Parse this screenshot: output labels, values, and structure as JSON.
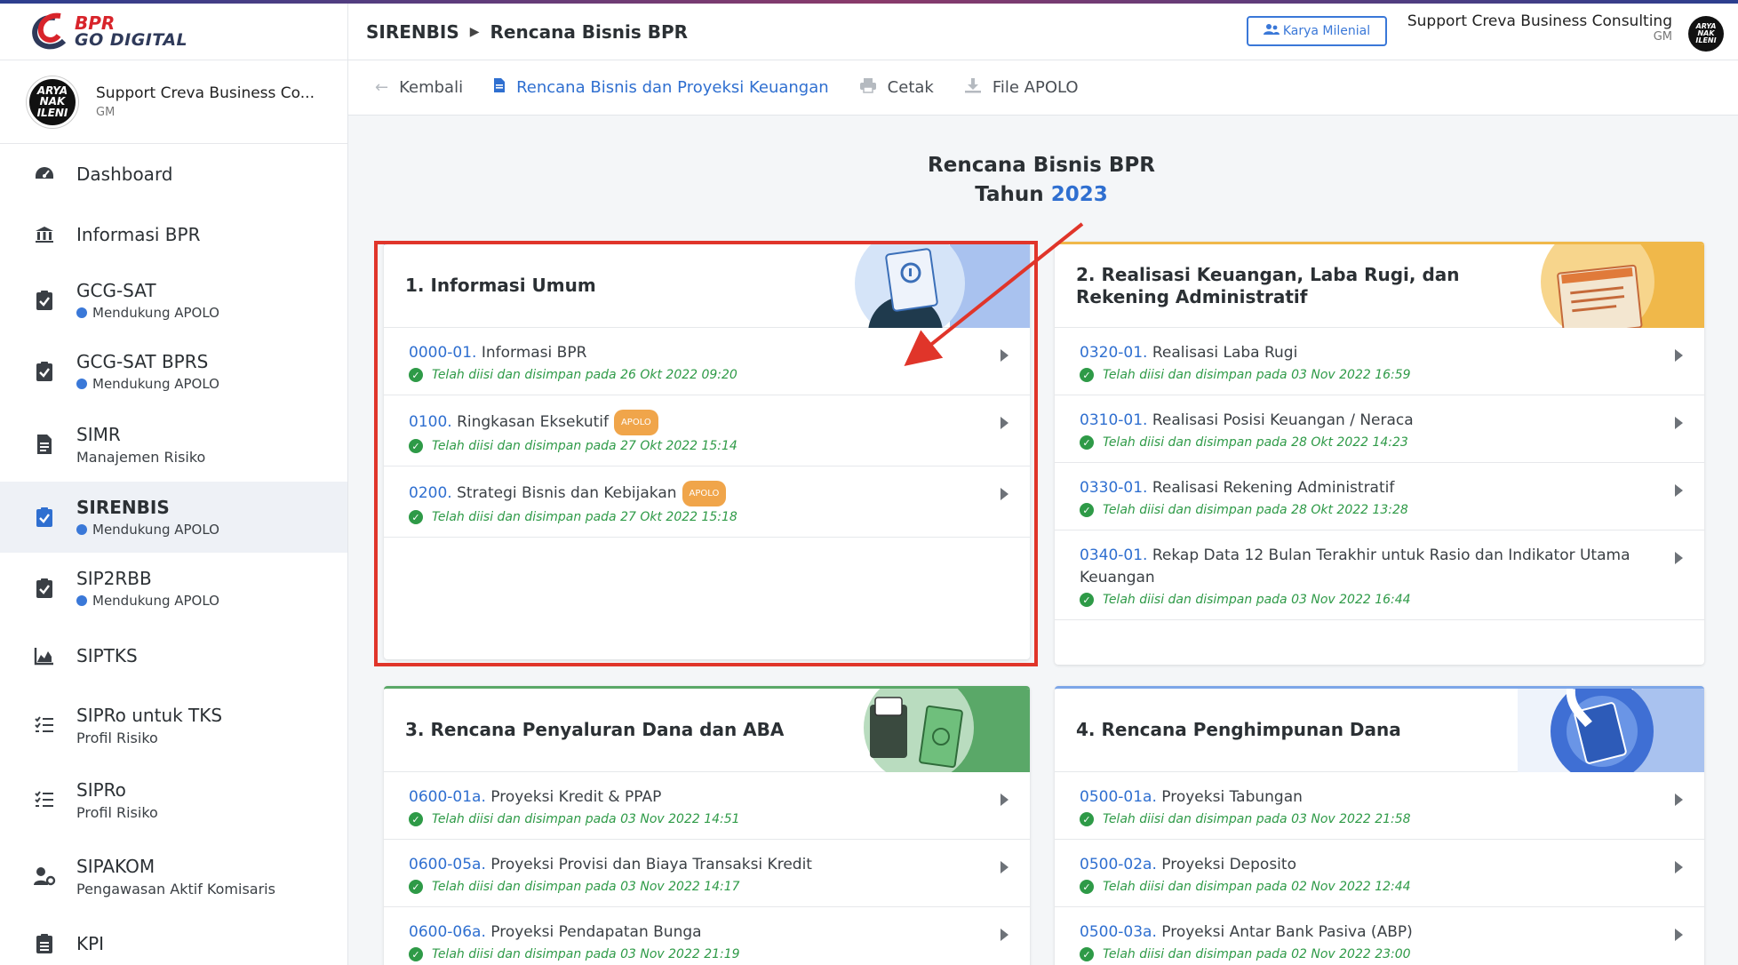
{
  "app": {
    "logo_line1": "BPR",
    "logo_line2": "GO DIGITAL"
  },
  "sidebar": {
    "user": {
      "name": "Support Creva Business Co...",
      "role": "GM",
      "avatar_text": [
        "ARYA",
        "NAK",
        "ILENI"
      ]
    },
    "items": [
      {
        "label": "Dashboard",
        "sub": "",
        "icon": "speedometer-icon"
      },
      {
        "label": "Informasi BPR",
        "sub": "",
        "icon": "bank-icon"
      },
      {
        "label": "GCG-SAT",
        "sub": "Mendukung APOLO",
        "icon": "clipboard-check-icon"
      },
      {
        "label": "GCG-SAT BPRS",
        "sub": "Mendukung APOLO",
        "icon": "clipboard-check-icon"
      },
      {
        "label": "SIMR",
        "sub": "Manajemen Risiko",
        "icon": "document-icon"
      },
      {
        "label": "SIRENBIS",
        "sub": "Mendukung APOLO",
        "icon": "clipboard-check-icon"
      },
      {
        "label": "SIP2RBB",
        "sub": "Mendukung APOLO",
        "icon": "clipboard-check-icon"
      },
      {
        "label": "SIPTKS",
        "sub": "",
        "icon": "area-chart-icon"
      },
      {
        "label": "SIPRo untuk TKS",
        "sub": "Profil Risiko",
        "icon": "checklist-icon"
      },
      {
        "label": "SIPRo",
        "sub": "Profil Risiko",
        "icon": "checklist-icon"
      },
      {
        "label": "SIPAKOM",
        "sub": "Pengawasan Aktif Komisaris",
        "icon": "user-settings-icon"
      },
      {
        "label": "KPI",
        "sub": "",
        "icon": "clipboard-list-icon"
      }
    ]
  },
  "header": {
    "breadcrumb_root": "SIRENBIS",
    "breadcrumb_current": "Rencana Bisnis BPR",
    "badge_label": "Karya Milenial",
    "user_name": "Support Creva Business Consulting",
    "user_role": "GM"
  },
  "toolbar": {
    "back": "Kembali",
    "doc": "Rencana Bisnis dan Proyeksi Keuangan",
    "print": "Cetak",
    "file": "File APOLO"
  },
  "page": {
    "title": "Rencana Bisnis BPR",
    "year_prefix": "Tahun",
    "year": "2023"
  },
  "cards": {
    "c1": {
      "title": "1. Informasi Umum",
      "rows": [
        {
          "code": "0000-01.",
          "name": "Informasi BPR",
          "apolo": "",
          "status": "Telah diisi dan disimpan pada 26 Okt 2022 09:20"
        },
        {
          "code": "0100.",
          "name": "Ringkasan Eksekutif",
          "apolo": "APOLO",
          "status": "Telah diisi dan disimpan pada 27 Okt 2022 15:14"
        },
        {
          "code": "0200.",
          "name": "Strategi Bisnis dan Kebijakan",
          "apolo": "APOLO",
          "status": "Telah diisi dan disimpan pada 27 Okt 2022 15:18"
        }
      ]
    },
    "c2": {
      "title": "2. Realisasi Keuangan, Laba Rugi, dan Rekening Administratif",
      "rows": [
        {
          "code": "0320-01.",
          "name": "Realisasi Laba Rugi",
          "status": "Telah diisi dan disimpan pada 03 Nov 2022 16:59"
        },
        {
          "code": "0310-01.",
          "name": "Realisasi Posisi Keuangan / Neraca",
          "status": "Telah diisi dan disimpan pada 28 Okt 2022 14:23"
        },
        {
          "code": "0330-01.",
          "name": "Realisasi Rekening Administratif",
          "status": "Telah diisi dan disimpan pada 28 Okt 2022 13:28"
        },
        {
          "code": "0340-01.",
          "name": "Rekap Data 12 Bulan Terakhir untuk Rasio dan Indikator Utama Keuangan",
          "status": "Telah diisi dan disimpan pada 03 Nov 2022 16:44"
        }
      ]
    },
    "c3": {
      "title": "3. Rencana Penyaluran Dana dan ABA",
      "rows": [
        {
          "code": "0600-01a.",
          "name": "Proyeksi Kredit & PPAP",
          "status": "Telah diisi dan disimpan pada 03 Nov 2022 14:51"
        },
        {
          "code": "0600-05a.",
          "name": "Proyeksi Provisi dan Biaya Transaksi Kredit",
          "status": "Telah diisi dan disimpan pada 03 Nov 2022 14:17"
        },
        {
          "code": "0600-06a.",
          "name": "Proyeksi Pendapatan Bunga",
          "status": "Telah diisi dan disimpan pada 03 Nov 2022 21:19"
        }
      ]
    },
    "c4": {
      "title": "4. Rencana Penghimpunan Dana",
      "rows": [
        {
          "code": "0500-01a.",
          "name": "Proyeksi Tabungan",
          "status": "Telah diisi dan disimpan pada 03 Nov 2022 21:58"
        },
        {
          "code": "0500-02a.",
          "name": "Proyeksi Deposito",
          "status": "Telah diisi dan disimpan pada 02 Nov 2022 12:44"
        },
        {
          "code": "0500-03a.",
          "name": "Proyeksi Antar Bank Pasiva (ABP)",
          "status": "Telah diisi dan disimpan pada 02 Nov 2022 23:00"
        }
      ]
    }
  },
  "colors": {
    "accent": "#2f6fd0",
    "success": "#2e9a47",
    "highlight": "#e0352a",
    "apolo_badge": "#f0a54a",
    "card1_top": "#7da6e8",
    "card2_top": "#f0b84a",
    "card3_top": "#5aa868",
    "card4_top": "#7da6e8"
  }
}
